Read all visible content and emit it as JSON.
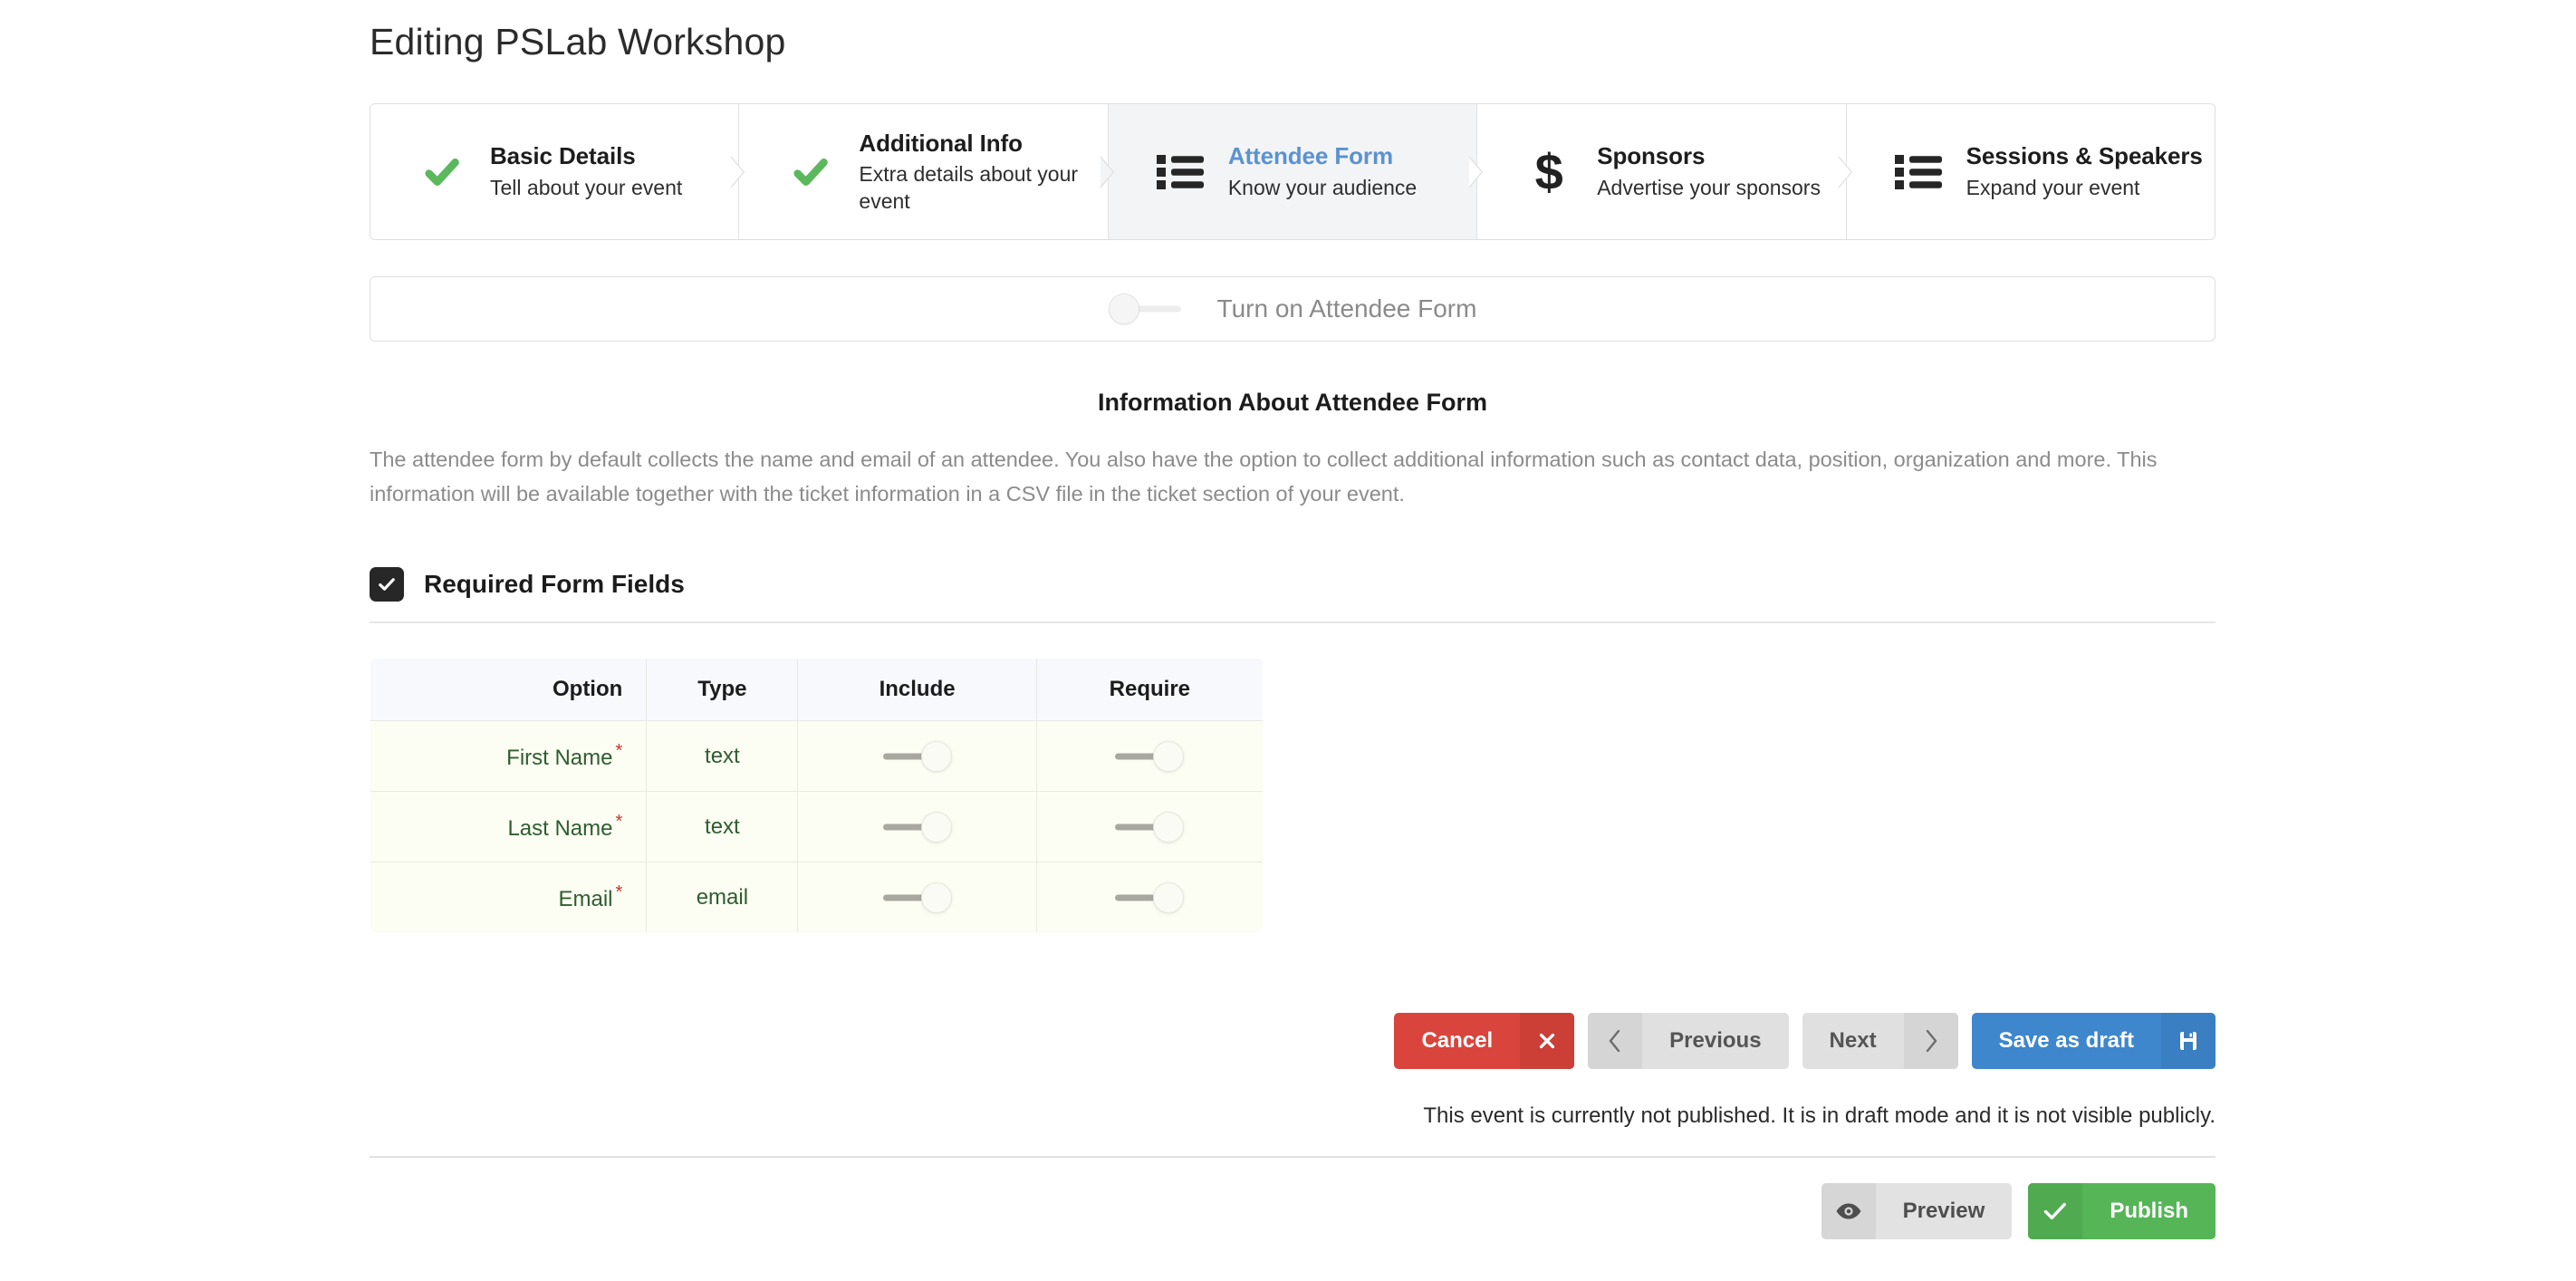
{
  "header": {
    "title": "Editing PSLab Workshop"
  },
  "wizard": {
    "steps": [
      {
        "title": "Basic Details",
        "subtitle": "Tell about your event",
        "icon": "check-icon",
        "state": "complete"
      },
      {
        "title": "Additional Info",
        "subtitle": "Extra details about your event",
        "icon": "check-icon",
        "state": "complete"
      },
      {
        "title": "Attendee Form",
        "subtitle": "Know your audience",
        "icon": "list-icon",
        "state": "active"
      },
      {
        "title": "Sponsors",
        "subtitle": "Advertise your sponsors",
        "icon": "dollar-icon",
        "state": "pending"
      },
      {
        "title": "Sessions & Speakers",
        "subtitle": "Expand your event",
        "icon": "list-icon",
        "state": "pending"
      }
    ]
  },
  "toggle_panel": {
    "label": "Turn on Attendee Form",
    "state": "off"
  },
  "info": {
    "title": "Information About Attendee Form",
    "body": "The attendee form by default collects the name and email of an attendee. You also have the option to collect additional information such as contact data, position, organization and more. This information will be available together with the ticket information in a CSV file in the ticket section of your event."
  },
  "required_fields": {
    "section_label": "Required Form Fields",
    "checkbox_state": "checked",
    "columns": [
      "Option",
      "Type",
      "Include",
      "Require"
    ],
    "rows": [
      {
        "option": "First Name",
        "required_marker": "*",
        "type": "text",
        "include": "on",
        "require": "on"
      },
      {
        "option": "Last Name",
        "required_marker": "*",
        "type": "text",
        "include": "on",
        "require": "on"
      },
      {
        "option": "Email",
        "required_marker": "*",
        "type": "email",
        "include": "on",
        "require": "on"
      }
    ]
  },
  "actions": {
    "cancel": "Cancel",
    "previous": "Previous",
    "next": "Next",
    "save_draft": "Save as draft"
  },
  "status": {
    "message": "This event is currently not published. It is in draft mode and it is not visible publicly."
  },
  "bottom_actions": {
    "preview": "Preview",
    "publish": "Publish"
  },
  "colors": {
    "accent_blue": "#3e87cd",
    "danger_red": "#d9453c",
    "success_green": "#56b557",
    "check_green": "#5cb85c",
    "active_step_text": "#5b92d0",
    "table_row_text": "#2f5d2f",
    "required_star": "#c0392b"
  }
}
